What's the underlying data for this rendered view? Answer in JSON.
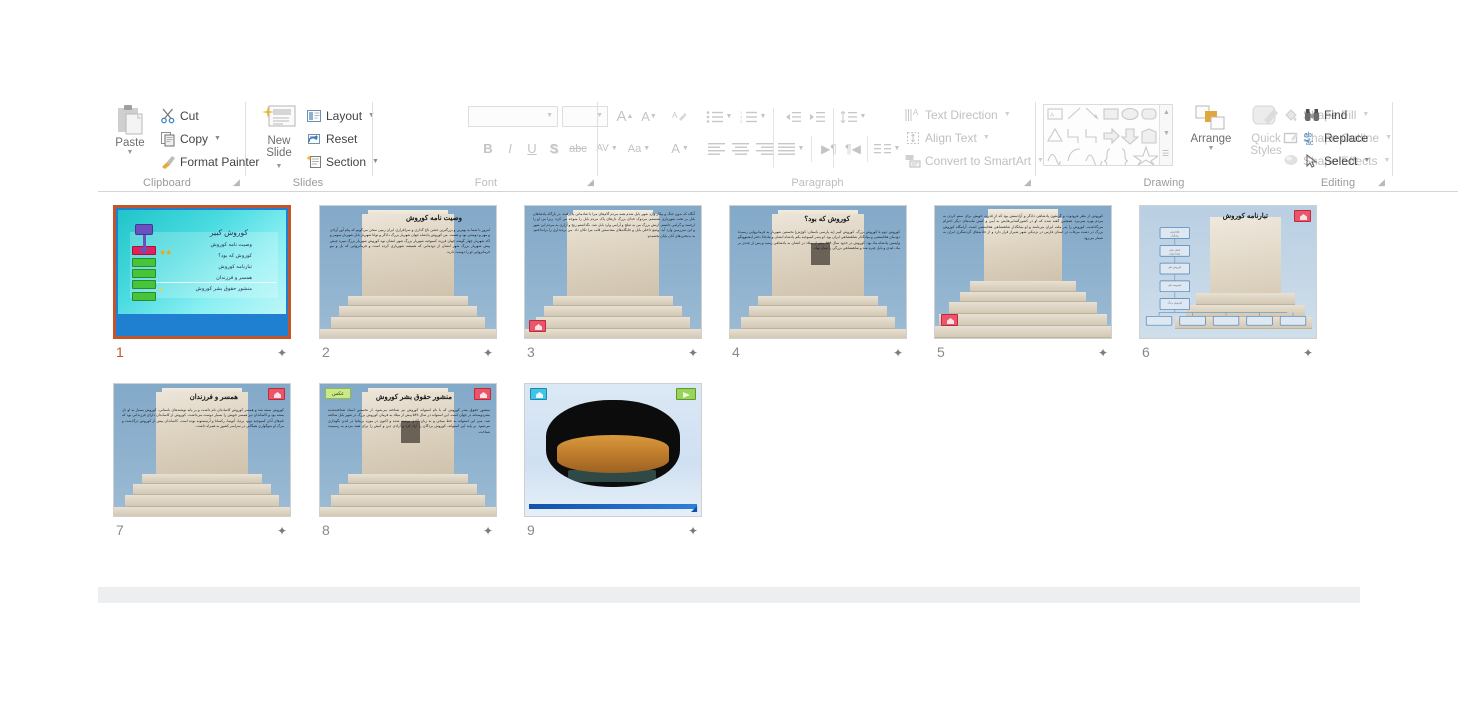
{
  "ribbon": {
    "groups": [
      {
        "label": "Clipboard",
        "has_launcher": true
      },
      {
        "label": "Slides",
        "has_launcher": false
      },
      {
        "label": "Font",
        "has_launcher": true
      },
      {
        "label": "Paragraph",
        "has_launcher": true
      },
      {
        "label": "Drawing",
        "has_launcher": true
      },
      {
        "label": "Editing",
        "has_launcher": false
      }
    ],
    "clipboard": {
      "paste_label": "Paste",
      "cut_label": "Cut",
      "copy_label": "Copy",
      "format_painter_label": "Format Painter"
    },
    "slides": {
      "new_slide_line1": "New",
      "new_slide_line2": "Slide",
      "layout_label": "Layout",
      "reset_label": "Reset",
      "section_label": "Section"
    },
    "font": {
      "font_name_value": "",
      "font_size_value": "",
      "grow_font": "A",
      "shrink_font": "A",
      "clear_formatting": "clear-formatting-icon",
      "bold": "B",
      "italic": "I",
      "underline": "U",
      "shadow": "S",
      "strikethrough": "abc",
      "character_spacing": "AV",
      "change_case": "Aa",
      "font_color": "A"
    },
    "paragraph": {
      "text_direction_label": "Text Direction",
      "align_text_label": "Align Text",
      "convert_smartart_label": "Convert to SmartArt"
    },
    "drawing": {
      "arrange_label": "Arrange",
      "quick_styles_line1": "Quick",
      "quick_styles_line2": "Styles",
      "shape_fill_label": "Shape Fill",
      "shape_outline_label": "Shape Outline",
      "shape_effects_label": "Shape Effects"
    },
    "editing": {
      "find_label": "Find",
      "replace_label": "Replace",
      "select_label": "Select"
    }
  },
  "colors": {
    "selection_border": "#c2552b",
    "selected_number": "#c2552b",
    "number": "#8a8a8a",
    "group_label": "#9a9a9a",
    "disabled": "#c0c0c0",
    "home_button": "#e9566a",
    "image_button": "#cde88a",
    "play_button": "#9ad35a",
    "info_button": "#43c3e8"
  },
  "presentation": {
    "menu_title": "کوروش کبیر",
    "menu_items": [
      "وصیت نامه کوروش",
      "کوروش که بود؟",
      "تبارنامه کوروش",
      "همسر و فرزندان",
      "منشور حقوق بشر کوروش"
    ],
    "slides": [
      {
        "number": "1",
        "kind": "menu",
        "title": "کوروش کبیر",
        "selected": true,
        "animated": true
      },
      {
        "number": "2",
        "kind": "tomb-text",
        "title": "وصیت نامه کوروش",
        "selected": false,
        "animated": true,
        "home_button": false
      },
      {
        "number": "3",
        "kind": "tomb-text",
        "title": "",
        "selected": false,
        "animated": true,
        "home_button": true
      },
      {
        "number": "4",
        "kind": "tomb-text",
        "title": "کوروش که بود؟",
        "selected": false,
        "animated": true,
        "home_button": false
      },
      {
        "number": "5",
        "kind": "tomb-text",
        "title": "",
        "selected": false,
        "animated": true,
        "home_button": true
      },
      {
        "number": "6",
        "kind": "chart",
        "title": "تبارنامه کوروش",
        "selected": false,
        "animated": true,
        "home_button": true
      },
      {
        "number": "7",
        "kind": "tomb-text",
        "title": "همسر و فرزندان",
        "selected": false,
        "animated": true,
        "home_button": true
      },
      {
        "number": "8",
        "kind": "tomb-text",
        "title": "منشور حقوق بشر کوروش",
        "selected": false,
        "animated": true,
        "home_button": true,
        "image_button_label": "عکس"
      },
      {
        "number": "9",
        "kind": "cylinder",
        "title": "",
        "selected": false,
        "animated": true,
        "home_button": false
      }
    ]
  }
}
